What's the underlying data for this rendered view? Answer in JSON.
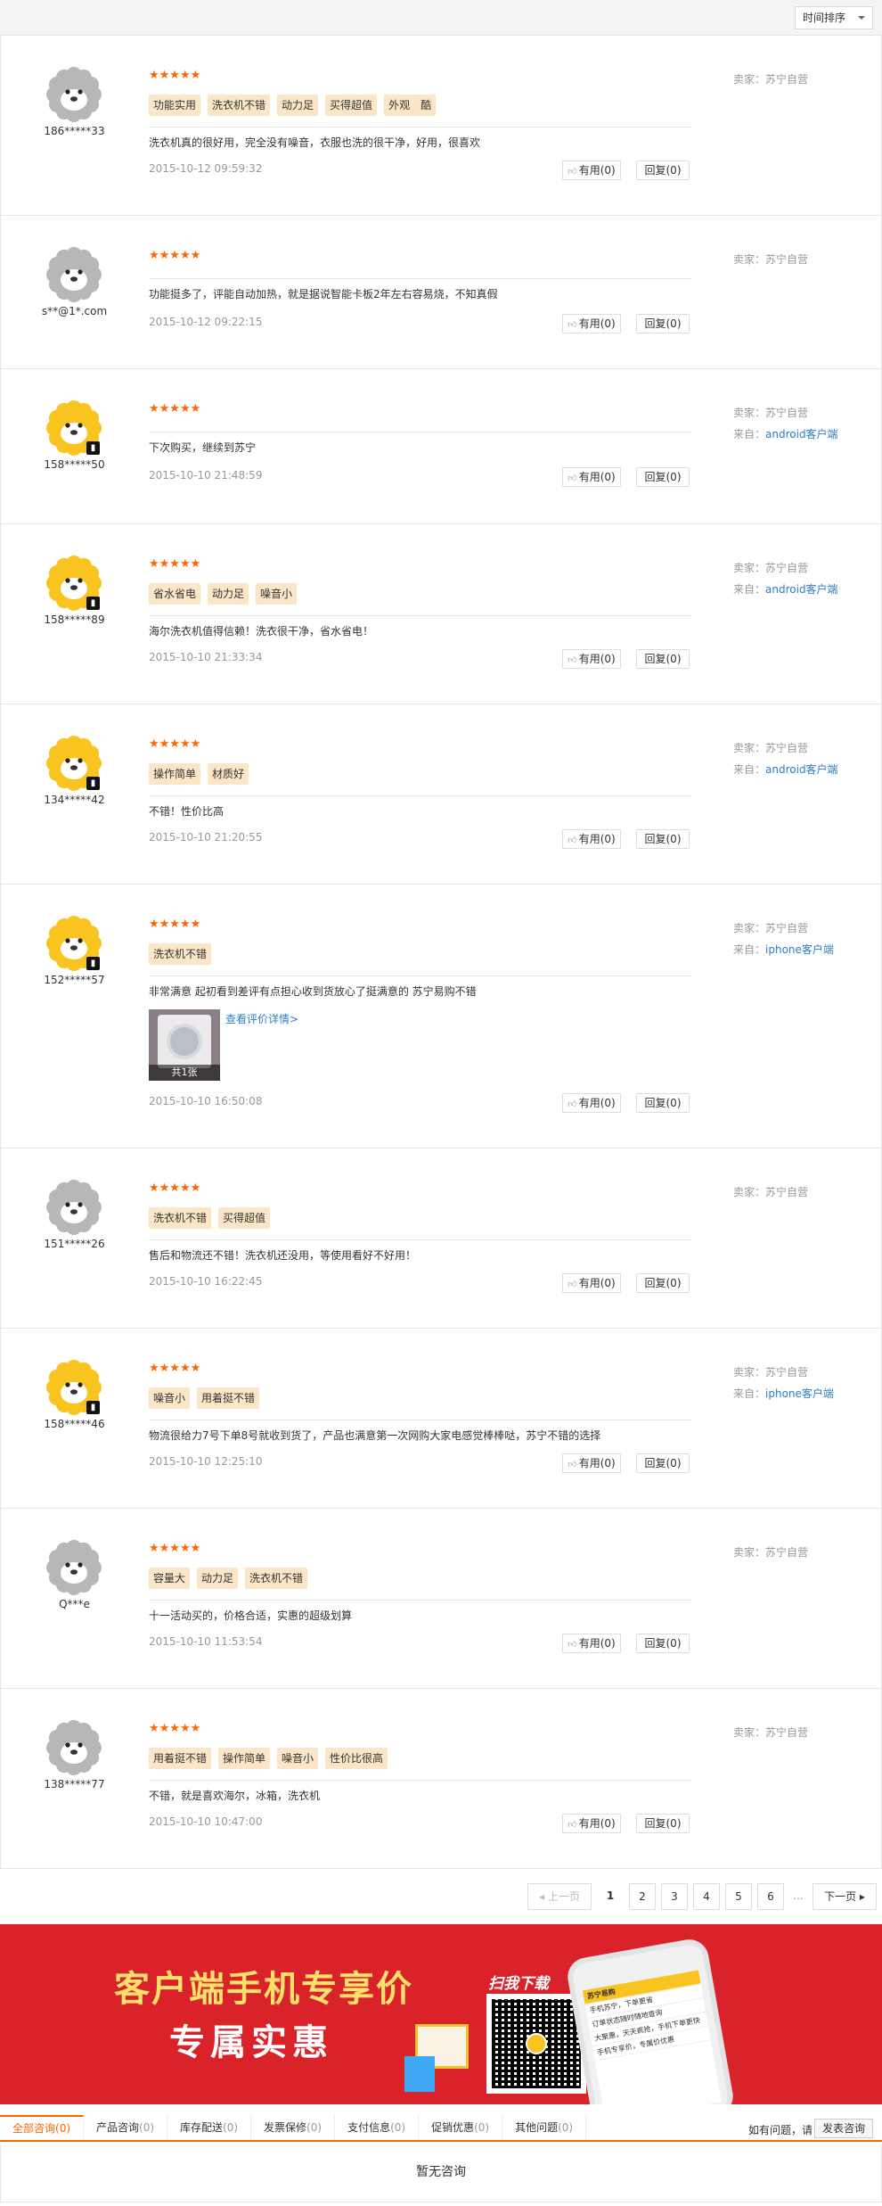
{
  "sort": {
    "label": "时间排序"
  },
  "labels": {
    "seller_prefix": "卖家：",
    "from_prefix": "来自：",
    "useful": "有用",
    "reply": "回复",
    "more": "查看评价详情>"
  },
  "colors": {
    "star": "#ff6600",
    "tag_bg": "#fbe6c7",
    "link": "#2e7dc9",
    "banner_bg": "#d9222a"
  },
  "reviews": [
    {
      "user": "186*****33",
      "avatar": "gray",
      "stars": "★★★★★",
      "tags": [
        "功能实用",
        "洗衣机不错",
        "动力足",
        "买得超值",
        "外观　酷"
      ],
      "text": "洗衣机真的很好用，完全没有噪音，衣服也洗的很干净，好用，很喜欢",
      "date": "2015-10-12 09:59:32",
      "useful": "有用(0)",
      "reply": "回复(0)",
      "seller": "苏宁自营",
      "from": ""
    },
    {
      "user": "s**@1*.com",
      "avatar": "gray",
      "stars": "★★★★★",
      "tags": [],
      "text": "功能挺多了，评能自动加热，就是据说智能卡板2年左右容易烧，不知真假",
      "date": "2015-10-12 09:22:15",
      "useful": "有用(0)",
      "reply": "回复(0)",
      "seller": "苏宁自营",
      "from": ""
    },
    {
      "user": "158*****50",
      "avatar": "yellow",
      "stars": "★★★★★",
      "tags": [],
      "text": "下次购买，继续到苏宁",
      "date": "2015-10-10 21:48:59",
      "useful": "有用(0)",
      "reply": "回复(0)",
      "seller": "苏宁自营",
      "from": "android客户端"
    },
    {
      "user": "158*****89",
      "avatar": "yellow",
      "stars": "★★★★★",
      "tags": [
        "省水省电",
        "动力足",
        "噪音小"
      ],
      "text": "海尔洗衣机值得信赖！洗衣很干净，省水省电！",
      "date": "2015-10-10 21:33:34",
      "useful": "有用(0)",
      "reply": "回复(0)",
      "seller": "苏宁自营",
      "from": "android客户端"
    },
    {
      "user": "134*****42",
      "avatar": "yellow",
      "stars": "★★★★★",
      "tags": [
        "操作简单",
        "材质好"
      ],
      "text": "不错！性价比高",
      "date": "2015-10-10 21:20:55",
      "useful": "有用(0)",
      "reply": "回复(0)",
      "seller": "苏宁自营",
      "from": "android客户端"
    },
    {
      "user": "152*****57",
      "avatar": "yellow",
      "stars": "★★★★★",
      "tags": [
        "洗衣机不错"
      ],
      "text": "非常满意 起初看到差评有点担心收到货放心了挺满意的 苏宁易购不错",
      "date": "2015-10-10 16:50:08",
      "useful": "有用(0)",
      "reply": "回复(0)",
      "seller": "苏宁自营",
      "from": "iphone客户端",
      "photo_caption": "共1张"
    },
    {
      "user": "151*****26",
      "avatar": "gray",
      "stars": "★★★★★",
      "tags": [
        "洗衣机不错",
        "买得超值"
      ],
      "text": "售后和物流还不错！洗衣机还没用，等使用看好不好用！",
      "date": "2015-10-10 16:22:45",
      "useful": "有用(0)",
      "reply": "回复(0)",
      "seller": "苏宁自营",
      "from": ""
    },
    {
      "user": "158*****46",
      "avatar": "yellow",
      "stars": "★★★★★",
      "tags": [
        "噪音小",
        "用着挺不错"
      ],
      "text": "物流很给力7号下单8号就收到货了，产品也满意第一次网购大家电感觉棒棒哒，苏宁不错的选择",
      "date": "2015-10-10 12:25:10",
      "useful": "有用(0)",
      "reply": "回复(0)",
      "seller": "苏宁自营",
      "from": "iphone客户端"
    },
    {
      "user": "Q***e",
      "avatar": "gray",
      "stars": "★★★★★",
      "tags": [
        "容量大",
        "动力足",
        "洗衣机不错"
      ],
      "text": "十一活动买的，价格合适，实惠的超级划算",
      "date": "2015-10-10 11:53:54",
      "useful": "有用(0)",
      "reply": "回复(0)",
      "seller": "苏宁自营",
      "from": ""
    },
    {
      "user": "138*****77",
      "avatar": "gray",
      "stars": "★★★★★",
      "tags": [
        "用着挺不错",
        "操作简单",
        "噪音小",
        "性价比很高"
      ],
      "text": "不错，就是喜欢海尔，冰箱，洗衣机",
      "date": "2015-10-10 10:47:00",
      "useful": "有用(0)",
      "reply": "回复(0)",
      "seller": "苏宁自营",
      "from": ""
    }
  ],
  "pager": {
    "prev": "上一页",
    "pages": [
      "1",
      "2",
      "3",
      "4",
      "5",
      "6"
    ],
    "dots": "...",
    "next": "下一页"
  },
  "banner": {
    "title1": "客户端手机专享价",
    "title2": "专属实惠",
    "scan": "扫我下载",
    "phone_rows": [
      "苏宁易购",
      "手机苏宁，下单更省",
      "订单状态随时随地查询",
      "大聚惠，天天疯抢，手机下单更快",
      "手机专享价，专属价优惠"
    ]
  },
  "consult": {
    "tabs": [
      {
        "label": "全部咨询",
        "count": "(0)"
      },
      {
        "label": "产品咨询",
        "count": "(0)"
      },
      {
        "label": "库存配送",
        "count": "(0)"
      },
      {
        "label": "发票保修",
        "count": "(0)"
      },
      {
        "label": "支付信息",
        "count": "(0)"
      },
      {
        "label": "促销优惠",
        "count": "(0)"
      },
      {
        "label": "其他问题",
        "count": "(0)"
      }
    ],
    "hint": "如有问题，请",
    "ask": "发表咨询",
    "empty": "暂无咨询"
  }
}
